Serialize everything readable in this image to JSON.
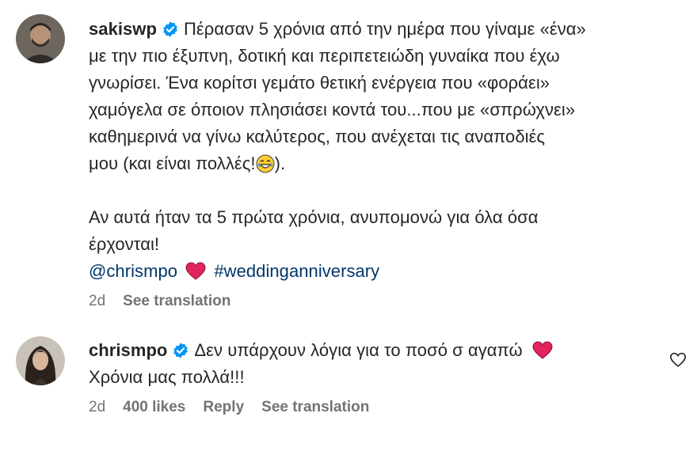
{
  "post": {
    "username": "sakiswp",
    "lines": [
      "Πέρασαν 5 χρόνια από την ημέρα που γίναμε «ένα»",
      "με την πιο έξυπνη, δοτική και περιπετειώδη γυναίκα που έχω",
      "γνωρίσει. Ένα κορίτσι γεμάτο θετική ενέργεια που «φοράει»",
      "χαμόγελα σε όποιον πλησιάσει κοντά του...που με «σπρώχνει»",
      "καθημερινά να γίνω καλύτερος, που ανέχεται τις αναποδιές",
      "μου (και είναι πολλές!",
      "Αν αυτά ήταν τα 5 πρώτα χρόνια, ανυπομονώ για όλα όσα",
      "έρχονται!"
    ],
    "line6_end": ").",
    "mention": "@chrismpo",
    "hashtag": "#weddinganniversary",
    "time": "2d",
    "see_translation": "See translation"
  },
  "reply": {
    "username": "chrismpo",
    "line1": "Δεν υπάρχουν λόγια για το ποσό σ αγαπώ",
    "line2": "Χρόνια μας πολλά!!!",
    "time": "2d",
    "likes": "400 likes",
    "reply_label": "Reply",
    "see_translation": "See translation"
  },
  "icons": {
    "verified": "verified-badge-icon",
    "heart": "red-heart-emoji",
    "laugh": "laughing-tears-emoji",
    "like": "heart-outline-icon"
  },
  "colors": {
    "text": "#262626",
    "link": "#00376b",
    "meta": "#737373",
    "verified": "#0095f6",
    "heart": "#e0245e"
  }
}
